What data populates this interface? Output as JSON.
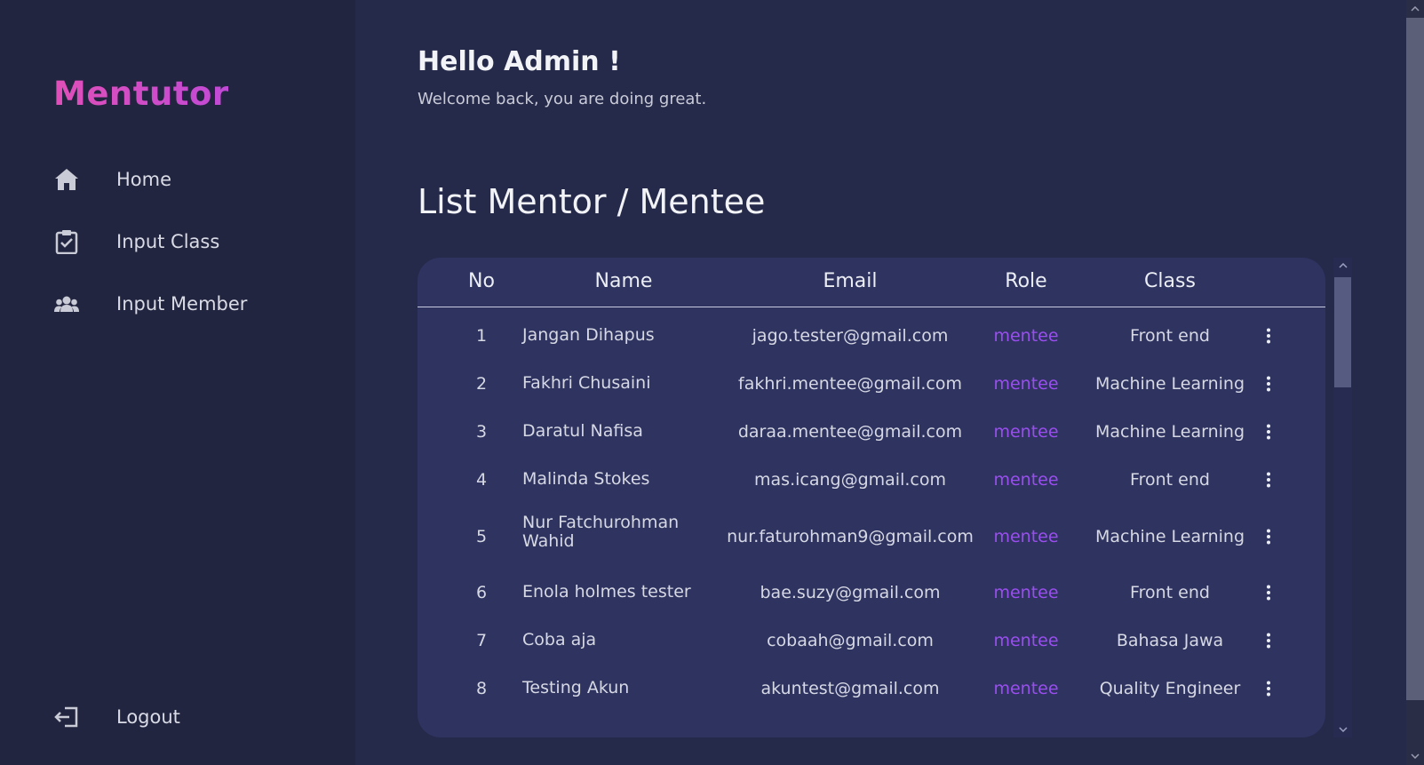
{
  "sidebar": {
    "brand": "Mentutor",
    "items": [
      {
        "label": "Home",
        "icon": "home-icon"
      },
      {
        "label": "Input Class",
        "icon": "clipboard-check-icon"
      },
      {
        "label": "Input Member",
        "icon": "users-icon"
      }
    ],
    "logout": {
      "label": "Logout",
      "icon": "logout-icon"
    }
  },
  "header": {
    "greeting": "Hello Admin !",
    "subtitle": "Welcome back, you are doing great."
  },
  "list": {
    "title": "List Mentor / Mentee",
    "columns": [
      "No",
      "Name",
      "Email",
      "Role",
      "Class"
    ],
    "rows": [
      {
        "no": "1",
        "name": "Jangan Dihapus",
        "email": "jago.tester@gmail.com",
        "role": "mentee",
        "class": "Front end"
      },
      {
        "no": "2",
        "name": "Fakhri Chusaini",
        "email": "fakhri.mentee@gmail.com",
        "role": "mentee",
        "class": "Machine Learning"
      },
      {
        "no": "3",
        "name": "Daratul Nafisa",
        "email": "daraa.mentee@gmail.com",
        "role": "mentee",
        "class": "Machine Learning"
      },
      {
        "no": "4",
        "name": "Malinda Stokes",
        "email": "mas.icang@gmail.com",
        "role": "mentee",
        "class": "Front end"
      },
      {
        "no": "5",
        "name": "Nur Fatchurohman Wahid",
        "email": "nur.faturohman9@gmail.com",
        "role": "mentee",
        "class": "Machine Learning"
      },
      {
        "no": "6",
        "name": "Enola holmes tester",
        "email": "bae.suzy@gmail.com",
        "role": "mentee",
        "class": "Front end"
      },
      {
        "no": "7",
        "name": "Coba aja",
        "email": "cobaah@gmail.com",
        "role": "mentee",
        "class": "Bahasa Jawa"
      },
      {
        "no": "8",
        "name": "Testing Akun",
        "email": "akuntest@gmail.com",
        "role": "mentee",
        "class": "Quality Engineer"
      }
    ]
  },
  "colors": {
    "background": "#262a4a",
    "sidebar": "#22253f",
    "table": "#2e3360",
    "brand": "#d94cc4",
    "role": "#9b4ef0"
  }
}
